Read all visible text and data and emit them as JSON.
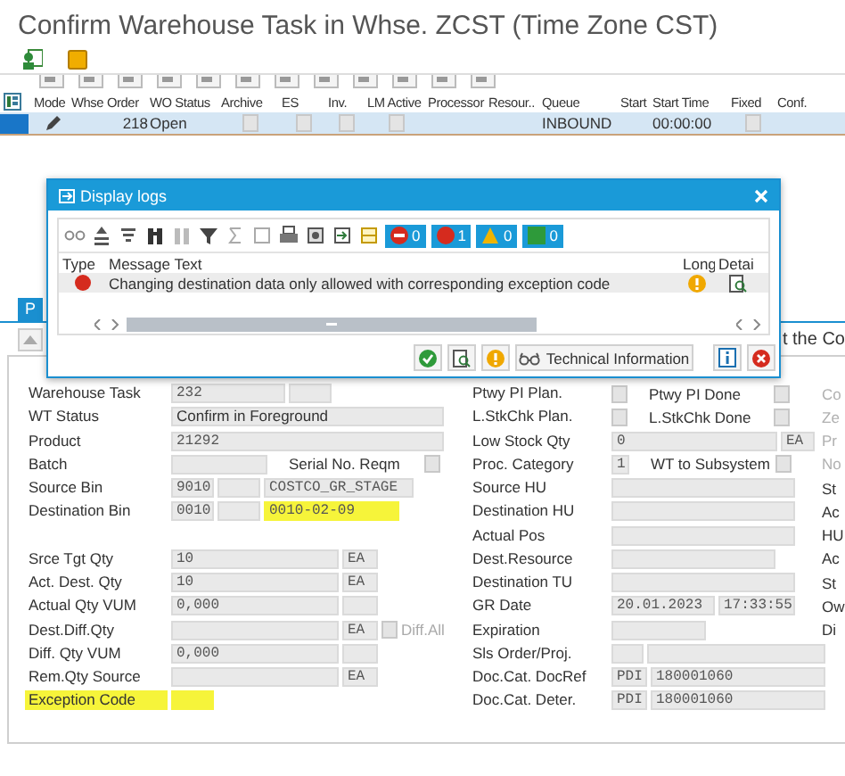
{
  "window": {
    "title": "Confirm Warehouse Task in Whse. ZCST (Time Zone CST)"
  },
  "task_table": {
    "columns": [
      "Mode",
      "Whse Order",
      "WO Status",
      "Archive",
      "ES",
      "Inv.",
      "LM Active",
      "Processor",
      "Resour..",
      "Queue",
      "Start",
      "Start Time",
      "Fixed",
      "Conf."
    ],
    "rows": [
      {
        "selected": true,
        "whse_order": "218",
        "wo_status": "Open",
        "archive": false,
        "es": false,
        "inv": false,
        "lm_active": false,
        "queue": "INBOUND",
        "start_time": "00:00:00",
        "fixed": false
      }
    ]
  },
  "background": {
    "tab": {
      "label": "P",
      "selected": true
    },
    "hint_text": "t the Co"
  },
  "form": {
    "left_rows": [
      {
        "kind": "field",
        "label": "Warehouse Task",
        "highlighted": false,
        "fields": [
          {
            "kind": "input",
            "value": "232",
            "highlighted": false
          },
          {
            "kind": "input",
            "highlighted": false
          }
        ]
      },
      {
        "kind": "field",
        "label": "WT Status",
        "highlighted": false,
        "fields": [
          {
            "kind": "display",
            "value": "Confirm in Foreground",
            "highlighted": false
          }
        ]
      },
      {
        "kind": "field",
        "label": "Product",
        "highlighted": false,
        "fields": [
          {
            "kind": "input",
            "value": "21292",
            "highlighted": false
          }
        ]
      },
      {
        "kind": "field",
        "label": "Batch",
        "highlighted": false,
        "fields": [
          {
            "kind": "input",
            "highlighted": false
          },
          {
            "kind": "text",
            "value": "Serial No. Reqm"
          },
          {
            "kind": "checkbox",
            "checked": false,
            "disabled": true
          }
        ]
      },
      {
        "kind": "field",
        "label": "Source Bin",
        "highlighted": false,
        "fields": [
          {
            "kind": "input",
            "value": "9010",
            "highlighted": false
          },
          {
            "kind": "input",
            "highlighted": false
          },
          {
            "kind": "input",
            "value": "COSTCO_GR_STAGE",
            "highlighted": false
          }
        ]
      },
      {
        "kind": "field",
        "label": "Destination Bin",
        "highlighted": false,
        "fields": [
          {
            "kind": "input",
            "value": "0010",
            "highlighted": false
          },
          {
            "kind": "input",
            "highlighted": false
          },
          {
            "kind": "input",
            "value": "0010-02-09",
            "highlighted": true
          }
        ]
      },
      {
        "kind": "blank"
      },
      {
        "kind": "field",
        "label": "Srce Tgt Qty",
        "highlighted": false,
        "fields": [
          {
            "kind": "input",
            "value": "10",
            "highlighted": false
          },
          {
            "kind": "input",
            "value": "EA",
            "highlighted": false
          }
        ]
      },
      {
        "kind": "field",
        "label": "Act. Dest. Qty",
        "highlighted": false,
        "fields": [
          {
            "kind": "input",
            "value": "10",
            "highlighted": false
          },
          {
            "kind": "input",
            "value": "EA",
            "highlighted": false
          }
        ]
      },
      {
        "kind": "field",
        "label": "Actual Qty VUM",
        "highlighted": false,
        "fields": [
          {
            "kind": "input",
            "value": "0,000",
            "highlighted": false
          },
          {
            "kind": "input",
            "highlighted": false
          }
        ]
      },
      {
        "kind": "field",
        "label": "Dest.Diff.Qty",
        "highlighted": false,
        "fields": [
          {
            "kind": "input",
            "highlighted": false
          },
          {
            "kind": "input",
            "value": "EA",
            "highlighted": false
          },
          {
            "kind": "checkbox",
            "checked": false,
            "disabled": true,
            "label": "Diff.All"
          }
        ]
      },
      {
        "kind": "field",
        "label": "Diff. Qty VUM",
        "highlighted": false,
        "fields": [
          {
            "kind": "input",
            "value": "0,000",
            "highlighted": false
          },
          {
            "kind": "input",
            "highlighted": false
          }
        ]
      },
      {
        "kind": "field",
        "label": "Rem.Qty Source",
        "highlighted": false,
        "fields": [
          {
            "kind": "input",
            "highlighted": false
          },
          {
            "kind": "input",
            "value": "EA",
            "highlighted": false
          }
        ]
      },
      {
        "kind": "field",
        "label": "Exception Code",
        "highlighted": true,
        "fields": [
          {
            "kind": "input",
            "highlighted": true
          }
        ]
      }
    ],
    "right_rows": [
      {
        "kind": "field",
        "label": "Ptwy PI Plan.",
        "highlighted": false,
        "fields": [
          {
            "kind": "checkbox",
            "checked": false,
            "disabled": true
          },
          {
            "kind": "text",
            "value": "Ptwy PI Done"
          },
          {
            "kind": "checkbox",
            "checked": false,
            "disabled": true
          }
        ],
        "side_label": {
          "text": "Co",
          "disabled": true
        }
      },
      {
        "kind": "field",
        "label": "L.StkChk Plan.",
        "highlighted": false,
        "fields": [
          {
            "kind": "checkbox",
            "checked": false,
            "disabled": true
          },
          {
            "kind": "text",
            "value": "L.StkChk Done"
          },
          {
            "kind": "checkbox",
            "checked": false,
            "disabled": true
          }
        ],
        "side_label": {
          "text": "Ze",
          "disabled": true
        }
      },
      {
        "kind": "field",
        "label": "Low Stock Qty",
        "highlighted": false,
        "fields": [
          {
            "kind": "input",
            "value": "0",
            "highlighted": false
          },
          {
            "kind": "input",
            "value": "EA",
            "highlighted": false
          }
        ],
        "side_label": {
          "text": "Pr",
          "disabled": true
        }
      },
      {
        "kind": "field",
        "label": "Proc. Category",
        "highlighted": false,
        "fields": [
          {
            "kind": "input",
            "value": "1",
            "highlighted": false
          },
          {
            "kind": "text",
            "value": "WT to Subsystem"
          },
          {
            "kind": "checkbox",
            "checked": false,
            "disabled": true
          }
        ],
        "side_label": {
          "text": "No",
          "disabled": true
        }
      },
      {
        "kind": "field",
        "label": "Source HU",
        "highlighted": false,
        "fields": [
          {
            "kind": "input",
            "highlighted": false
          }
        ],
        "side_label": {
          "text": "St",
          "disabled": false
        }
      },
      {
        "kind": "field",
        "label": "Destination HU",
        "highlighted": false,
        "fields": [
          {
            "kind": "input",
            "highlighted": false
          }
        ],
        "side_label": {
          "text": "Ac",
          "disabled": false
        }
      },
      {
        "kind": "field",
        "label": "Actual Pos",
        "highlighted": false,
        "fields": [
          {
            "kind": "input",
            "highlighted": false
          }
        ],
        "side_label": {
          "text": "HU",
          "disabled": false
        }
      },
      {
        "kind": "field",
        "label": "Dest.Resource",
        "highlighted": false,
        "fields": [
          {
            "kind": "input",
            "highlighted": false
          }
        ],
        "side_label": {
          "text": "Ac",
          "disabled": false
        }
      },
      {
        "kind": "field",
        "label": "Destination TU",
        "highlighted": false,
        "fields": [
          {
            "kind": "input",
            "highlighted": false
          }
        ],
        "side_label": {
          "text": "St",
          "disabled": false
        }
      },
      {
        "kind": "field",
        "label": "GR Date",
        "highlighted": false,
        "fields": [
          {
            "kind": "input",
            "value": "20.01.2023",
            "highlighted": false
          },
          {
            "kind": "input",
            "value": "17:33:55",
            "highlighted": false
          }
        ],
        "side_label": {
          "text": "Ow",
          "disabled": false
        }
      },
      {
        "kind": "field",
        "label": "Expiration",
        "highlighted": false,
        "fields": [
          {
            "kind": "input",
            "highlighted": false
          }
        ],
        "side_label": {
          "text": "Di",
          "disabled": false
        }
      },
      {
        "kind": "field",
        "label": "Sls Order/Proj.",
        "highlighted": false,
        "fields": [
          {
            "kind": "input",
            "highlighted": false
          },
          {
            "kind": "input",
            "highlighted": false
          }
        ]
      },
      {
        "kind": "field",
        "label": "Doc.Cat. DocRef",
        "highlighted": false,
        "fields": [
          {
            "kind": "input",
            "value": "PDI",
            "highlighted": false
          },
          {
            "kind": "input",
            "value": "180001060",
            "highlighted": false
          }
        ]
      },
      {
        "kind": "field",
        "label": "Doc.Cat. Deter.",
        "highlighted": false,
        "fields": [
          {
            "kind": "input",
            "value": "PDI",
            "highlighted": false
          },
          {
            "kind": "input",
            "value": "180001060",
            "highlighted": false
          }
        ]
      }
    ]
  },
  "dialog": {
    "title": "Display logs",
    "counters": [
      {
        "kind": "stop",
        "count": "0"
      },
      {
        "kind": "error",
        "count": "1"
      },
      {
        "kind": "warning",
        "count": "0"
      },
      {
        "kind": "success",
        "count": "0"
      }
    ],
    "columns": [
      "Type",
      "Message Text",
      "Long",
      "Detai"
    ],
    "messages": [
      {
        "kind": "error",
        "text": "Changing destination data only allowed with corresponding exception code"
      }
    ],
    "buttons": [
      {
        "kind": "continue"
      },
      {
        "kind": "detail"
      },
      {
        "kind": "help"
      },
      {
        "kind": "technical",
        "label": "Technical Information"
      },
      {
        "kind": "info"
      },
      {
        "kind": "cancel"
      }
    ]
  }
}
